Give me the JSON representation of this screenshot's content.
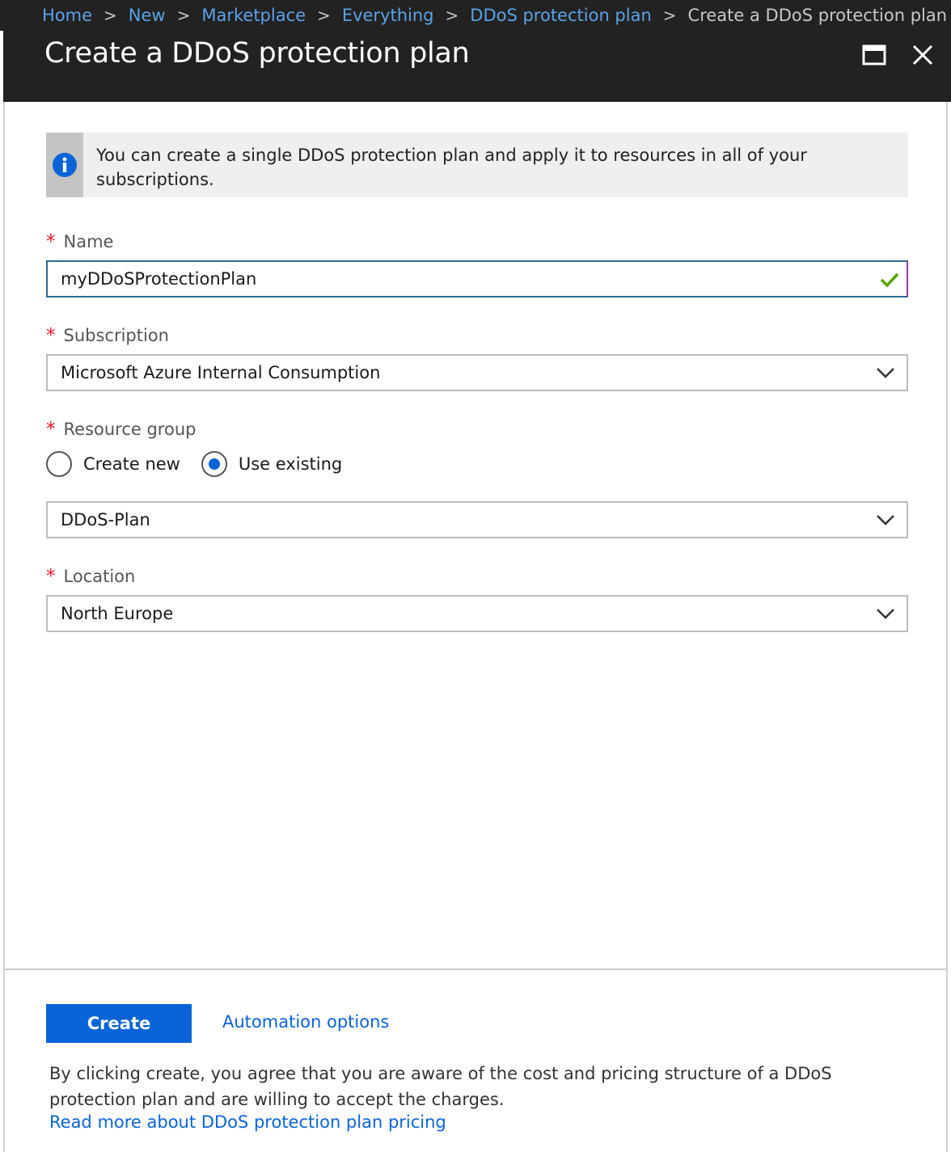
{
  "breadcrumb": {
    "items": [
      "Home",
      "New",
      "Marketplace",
      "Everything",
      "DDoS protection plan"
    ],
    "current": "Create a DDoS protection plan"
  },
  "blade": {
    "title": "Create a DDoS protection plan"
  },
  "info": {
    "text": "You can create a single DDoS protection plan and apply it to resources in all of your subscriptions."
  },
  "form": {
    "required_marker": "*",
    "name": {
      "label": "Name",
      "value": "myDDoSProtectionPlan",
      "valid": true
    },
    "subscription": {
      "label": "Subscription",
      "value": "Microsoft Azure Internal Consumption"
    },
    "resource_group": {
      "label": "Resource group",
      "options": [
        "Create new",
        "Use existing"
      ],
      "selected": "Use existing",
      "value": "DDoS-Plan"
    },
    "location": {
      "label": "Location",
      "value": "North Europe"
    }
  },
  "footer": {
    "create_label": "Create",
    "automation_label": "Automation options",
    "disclaimer": "By clicking create, you agree that you are aware of the cost and pricing structure of a DDoS protection plan and are willing to accept the charges.",
    "pricing_link": "Read more about DDoS protection plan pricing"
  },
  "colors": {
    "accent": "#0a64d8",
    "header_bg": "#222222",
    "link": "#5aa2e6",
    "required": "#e81123",
    "valid": "#57a300"
  },
  "icons": {
    "info": "info-icon",
    "maximize": "maximize-icon",
    "close": "close-icon",
    "chevron": "chevron-down-icon",
    "check": "checkmark-icon"
  }
}
